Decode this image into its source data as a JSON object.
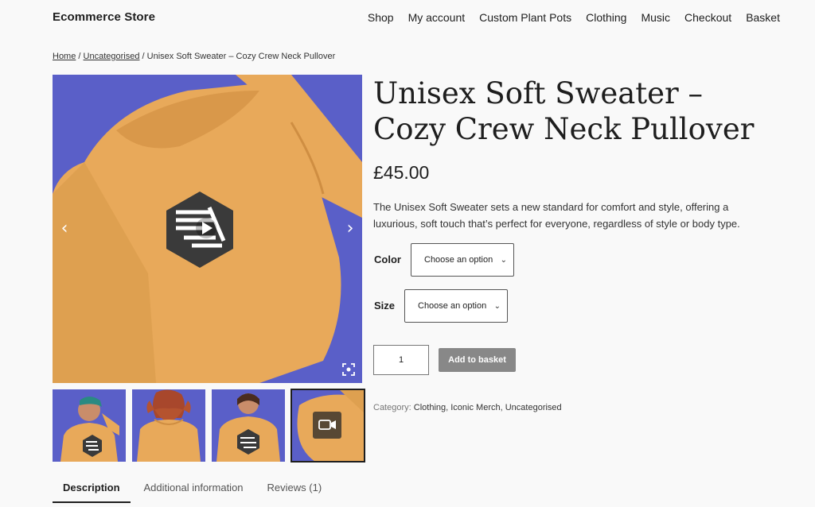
{
  "site": {
    "title": "Ecommerce Store"
  },
  "nav": [
    "Shop",
    "My account",
    "Custom Plant Pots",
    "Clothing",
    "Music",
    "Checkout",
    "Basket"
  ],
  "breadcrumb": {
    "home": "Home",
    "category": "Uncategorised",
    "separator": "/",
    "current": "Unisex Soft Sweater – Cozy Crew Neck Pullover"
  },
  "product": {
    "title": "Unisex Soft Sweater – Cozy Crew Neck Pullover",
    "price": "£45.00",
    "description": "The Unisex Soft Sweater sets a new standard for comfort and style, offering a luxurious, soft touch that’s perfect for everyone, regardless of style or body type.",
    "variations": [
      {
        "label": "Color",
        "value": "Choose an option"
      },
      {
        "label": "Size",
        "value": "Choose an option"
      }
    ],
    "quantity": "1",
    "add_to_basket": "Add to basket",
    "category_label": "Category:",
    "categories": [
      "Clothing",
      "Iconic Merch",
      "Uncategorised"
    ]
  },
  "gallery": {
    "prev_icon": "chevron-left-icon",
    "next_icon": "chevron-right-icon",
    "zoom_icon": "fullscreen-zoom-icon",
    "colors": {
      "background": "#5a5fc8",
      "sweater": "#e8a95a"
    }
  },
  "tabs": [
    "Description",
    "Additional information",
    "Reviews (1)"
  ],
  "colors": {
    "accent": "#1e1e1e",
    "button": "#888888",
    "page_bg": "#f9f9f9"
  }
}
